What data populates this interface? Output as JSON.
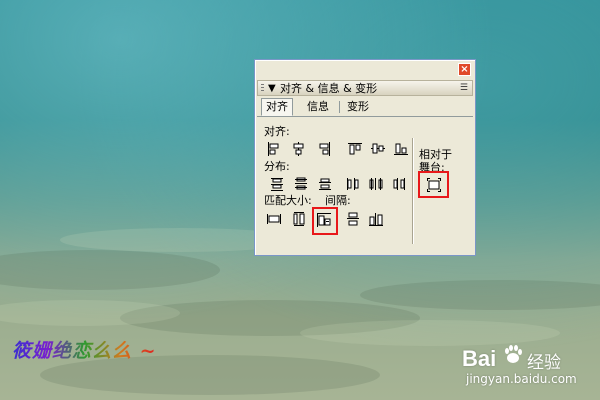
{
  "panel": {
    "title": "对齐 & 信息 & 变形",
    "close_glyph": "×",
    "tabs": [
      {
        "label": "对齐",
        "active": true
      },
      {
        "label": "信息",
        "active": false
      },
      {
        "label": "变形",
        "active": false
      }
    ],
    "sections": {
      "align_label": "对齐:",
      "distribute_label": "分布:",
      "match_size_label": "匹配大小:",
      "spacing_label": "间隔:",
      "relative_label": "相对于",
      "stage_label": "舞台:"
    },
    "highlight_color": "#e8181a"
  },
  "watermark": {
    "signature": "筱姗绝恋么么 ~",
    "logo_text": "Bai",
    "logo_suffix": "经验",
    "url": "jingyan.baidu.com"
  }
}
